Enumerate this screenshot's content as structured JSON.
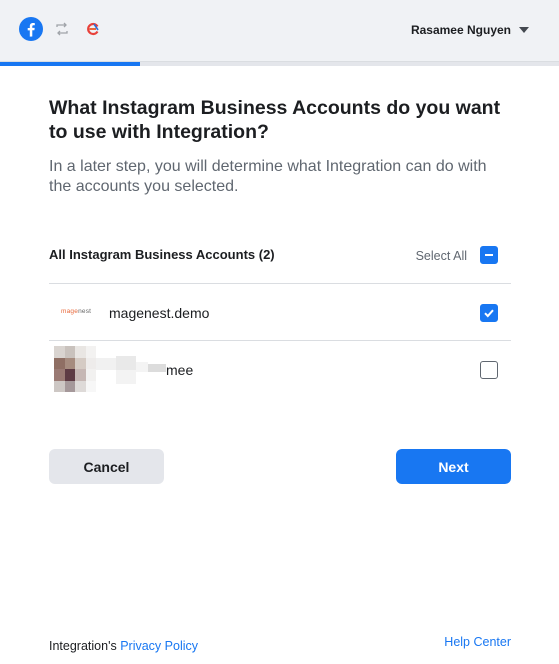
{
  "header": {
    "user_name": "Rasamee Nguyen"
  },
  "progress": {
    "fraction": 0.25
  },
  "main": {
    "title": "What Instagram Business Accounts do you want to use with Integration?",
    "subtitle": "In a later step, you will determine what Integration can do with the accounts you selected."
  },
  "accounts": {
    "header_title": "All Instagram Business Accounts (2)",
    "select_all_label": "Select All",
    "select_all_state": "partial",
    "items": [
      {
        "name": "magenest.demo",
        "logo_text": "magenest",
        "checked": true
      },
      {
        "name": "mee",
        "checked": false
      }
    ]
  },
  "buttons": {
    "cancel": "Cancel",
    "next": "Next"
  },
  "footer": {
    "prefix": "Integration's",
    "privacy_policy": "Privacy Policy",
    "help_center": "Help Center"
  },
  "colors": {
    "accent": "#1877f2",
    "logo_orange": "#e8683a"
  },
  "icons": {
    "header_left": [
      "facebook-icon",
      "swap-accounts-icon",
      "app-logo-icon"
    ],
    "user_menu": "caret-down-icon"
  }
}
